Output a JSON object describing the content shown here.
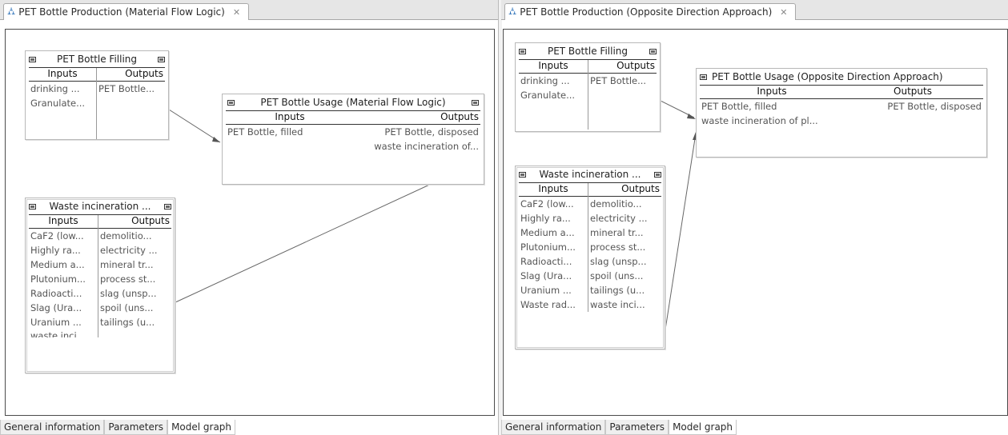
{
  "left": {
    "tab_title": "PET Bottle Production (Material Flow Logic)",
    "bottom_tabs": [
      "General information",
      "Parameters",
      "Model graph"
    ],
    "nodes": {
      "filling": {
        "title": "PET Bottle Filling",
        "inputs_label": "Inputs",
        "outputs_label": "Outputs",
        "inputs": [
          "drinking ...",
          "Granulate..."
        ],
        "outputs": [
          "PET Bottle..."
        ]
      },
      "usage": {
        "title": "PET Bottle Usage (Material Flow Logic)",
        "inputs_label": "Inputs",
        "outputs_label": "Outputs",
        "inputs": [
          "PET Bottle, filled"
        ],
        "outputs": [
          "PET Bottle, disposed",
          "waste incineration of..."
        ]
      },
      "waste": {
        "title": "Waste incineration ...",
        "inputs_label": "Inputs",
        "outputs_label": "Outputs",
        "inputs": [
          "CaF2 (low...",
          "Highly ra...",
          "Medium a...",
          "Plutonium...",
          "Radioacti...",
          "Slag (Ura...",
          "Uranium ...",
          "waste inci..."
        ],
        "outputs": [
          "demolitio...",
          "electricity ...",
          "mineral tr...",
          "process st...",
          "slag (unsp...",
          "spoil (uns...",
          "tailings (u..."
        ]
      }
    }
  },
  "right": {
    "tab_title": "PET Bottle Production (Opposite Direction Approach)",
    "bottom_tabs": [
      "General information",
      "Parameters",
      "Model graph"
    ],
    "nodes": {
      "filling": {
        "title": "PET Bottle Filling",
        "inputs_label": "Inputs",
        "outputs_label": "Outputs",
        "inputs": [
          "drinking ...",
          "Granulate..."
        ],
        "outputs": [
          "PET Bottle..."
        ]
      },
      "usage": {
        "title": "PET Bottle Usage (Opposite Direction Approach)",
        "inputs_label": "Inputs",
        "outputs_label": "Outputs",
        "inputs": [
          "PET Bottle, filled",
          "waste incineration of pl..."
        ],
        "outputs": [
          "PET Bottle, disposed"
        ]
      },
      "waste": {
        "title": "Waste incineration ...",
        "inputs_label": "Inputs",
        "outputs_label": "Outputs",
        "inputs": [
          "CaF2 (low...",
          "Highly ra...",
          "Medium a...",
          "Plutonium...",
          "Radioacti...",
          "Slag (Ura...",
          "Uranium ...",
          "Waste rad..."
        ],
        "outputs": [
          "demolitio...",
          "electricity ...",
          "mineral tr...",
          "process st...",
          "slag (unsp...",
          "spoil (uns...",
          "tailings (u...",
          "waste inci..."
        ]
      }
    }
  },
  "icons": {
    "tab_icon": "hierarchy-icon",
    "close_icon": "close-icon",
    "node_toggle": "collapse-marker-icon"
  },
  "colors": {
    "tab_icon": "#2a6fb8",
    "border": "#4b4b4b"
  }
}
